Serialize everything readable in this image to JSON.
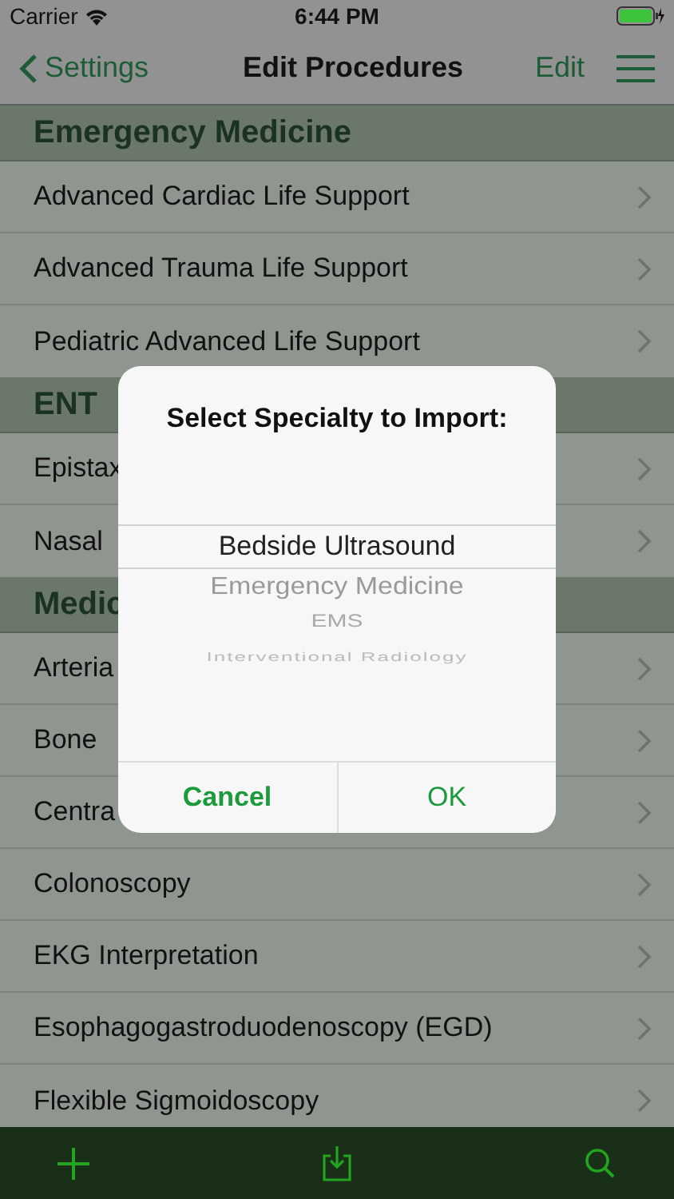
{
  "status_bar": {
    "carrier": "Carrier",
    "time": "6:44 PM"
  },
  "nav": {
    "back": "Settings",
    "title": "Edit Procedures",
    "edit": "Edit"
  },
  "sections": [
    {
      "title": "Emergency Medicine",
      "rows": [
        "Advanced Cardiac Life Support",
        "Advanced Trauma Life Support",
        "Pediatric Advanced Life Support"
      ]
    },
    {
      "title": "ENT",
      "rows": [
        "Epistax",
        "Nasal"
      ]
    },
    {
      "title": "Medic",
      "rows": [
        "Arteria",
        "Bone",
        "Centra",
        "Colonoscopy",
        "EKG Interpretation",
        "Esophagogastroduodenoscopy (EGD)",
        "Flexible Sigmoidoscopy"
      ]
    }
  ],
  "dialog": {
    "title": "Select Specialty to Import:",
    "options": [
      {
        "label": "Bedside Ultrasound",
        "selected": true
      },
      {
        "label": "Emergency Medicine",
        "selected": false
      },
      {
        "label": "EMS",
        "selected": false
      },
      {
        "label": "Interventional Radiology",
        "selected": false
      }
    ],
    "cancel": "Cancel",
    "ok": "OK"
  }
}
